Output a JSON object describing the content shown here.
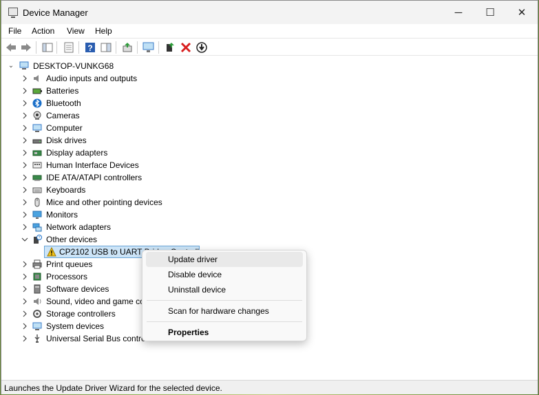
{
  "window": {
    "title": "Device Manager"
  },
  "window_controls": {
    "minimize": "─",
    "maximize": "☐",
    "close": "✕"
  },
  "menu": [
    "File",
    "Action",
    "View",
    "Help"
  ],
  "toolbar": {
    "icons": [
      "back-arrow-icon",
      "forward-arrow-icon",
      "show-hide-console-tree-icon",
      "properties-icon",
      "help-icon",
      "action-pane-icon",
      "update-driver-icon",
      "scan-hardware-icon",
      "add-legacy-hardware-icon",
      "uninstall-device-icon",
      "disable-device-icon"
    ]
  },
  "tree": {
    "root": "DESKTOP-VUNKG68",
    "categories": [
      {
        "label": "Audio inputs and outputs",
        "icon": "speaker-icon",
        "expanded": false
      },
      {
        "label": "Batteries",
        "icon": "battery-icon",
        "expanded": false
      },
      {
        "label": "Bluetooth",
        "icon": "bluetooth-icon",
        "expanded": false
      },
      {
        "label": "Cameras",
        "icon": "camera-icon",
        "expanded": false
      },
      {
        "label": "Computer",
        "icon": "computer-icon",
        "expanded": false
      },
      {
        "label": "Disk drives",
        "icon": "disk-drive-icon",
        "expanded": false
      },
      {
        "label": "Display adapters",
        "icon": "display-adapter-icon",
        "expanded": false
      },
      {
        "label": "Human Interface Devices",
        "icon": "hid-icon",
        "expanded": false
      },
      {
        "label": "IDE ATA/ATAPI controllers",
        "icon": "ide-controller-icon",
        "expanded": false
      },
      {
        "label": "Keyboards",
        "icon": "keyboard-icon",
        "expanded": false
      },
      {
        "label": "Mice and other pointing devices",
        "icon": "mouse-icon",
        "expanded": false
      },
      {
        "label": "Monitors",
        "icon": "monitor-icon",
        "expanded": false
      },
      {
        "label": "Network adapters",
        "icon": "network-adapter-icon",
        "expanded": false
      },
      {
        "label": "Other devices",
        "icon": "other-devices-icon",
        "expanded": true
      },
      {
        "label": "Print queues",
        "icon": "printer-icon",
        "expanded": false
      },
      {
        "label": "Processors",
        "icon": "processor-icon",
        "expanded": false
      },
      {
        "label": "Software devices",
        "icon": "software-device-icon",
        "expanded": false
      },
      {
        "label": "Sound, video and game co",
        "icon": "sound-icon",
        "expanded": false
      },
      {
        "label": "Storage controllers",
        "icon": "storage-controller-icon",
        "expanded": false
      },
      {
        "label": "System devices",
        "icon": "system-devices-icon",
        "expanded": false
      },
      {
        "label": "Universal Serial Bus contro",
        "icon": "usb-icon",
        "expanded": false
      }
    ],
    "selected_child": {
      "label": "CP2102 USB to UART Bridge Controll",
      "icon": "warning-device-icon"
    }
  },
  "context_menu": {
    "items": [
      {
        "label": "Update driver",
        "bold": false,
        "highlighted": true
      },
      {
        "label": "Disable device",
        "bold": false,
        "highlighted": false
      },
      {
        "label": "Uninstall device",
        "bold": false,
        "highlighted": false
      },
      {
        "label": "Scan for hardware changes",
        "bold": false,
        "highlighted": false
      },
      {
        "label": "Properties",
        "bold": true,
        "highlighted": false
      }
    ]
  },
  "status_bar": {
    "text": "Launches the Update Driver Wizard for the selected device."
  },
  "colors": {
    "selection_bg": "#cce4f7",
    "selection_border": "#66a3d6",
    "accent_blue": "#1a6fc9",
    "error_red": "#d81e1e"
  }
}
